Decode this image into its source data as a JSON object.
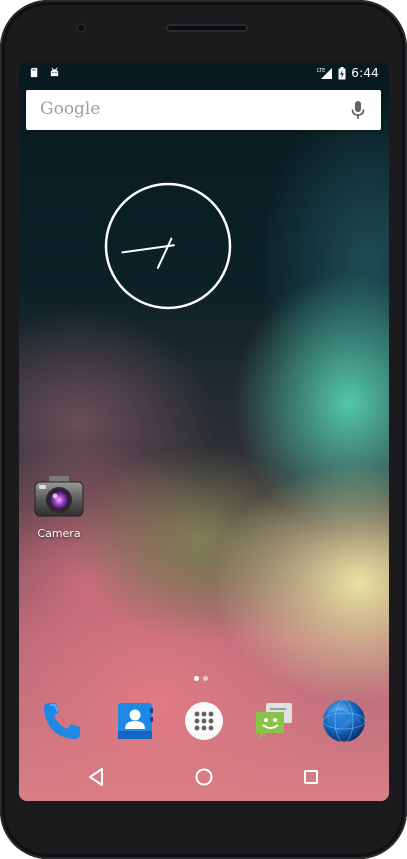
{
  "status_bar": {
    "time": "6:44",
    "network_label": "LTE",
    "left_icons": [
      "sd-card-icon",
      "android-debug-icon"
    ],
    "right_icons": [
      "lte-signal-icon",
      "battery-charging-icon"
    ]
  },
  "search": {
    "label": "Google",
    "mic_icon": "mic-icon"
  },
  "clock": {
    "hour_hand_deg": 262,
    "minute_hand_deg": 205
  },
  "home_apps": [
    {
      "label": "Camera",
      "icon": "camera-icon"
    }
  ],
  "page_indicator": {
    "pages": 2,
    "current": 0
  },
  "dock": [
    {
      "name": "phone",
      "icon": "phone-icon"
    },
    {
      "name": "contacts",
      "icon": "contacts-icon"
    },
    {
      "name": "all-apps",
      "icon": "app-drawer-icon"
    },
    {
      "name": "messaging",
      "icon": "messaging-icon"
    },
    {
      "name": "browser",
      "icon": "globe-icon"
    }
  ],
  "navigation": [
    "back-icon",
    "home-icon",
    "recents-icon"
  ],
  "colors": {
    "accent_blue": "#1e88e5",
    "messaging_green": "#8bc34a",
    "white": "#ffffff"
  }
}
